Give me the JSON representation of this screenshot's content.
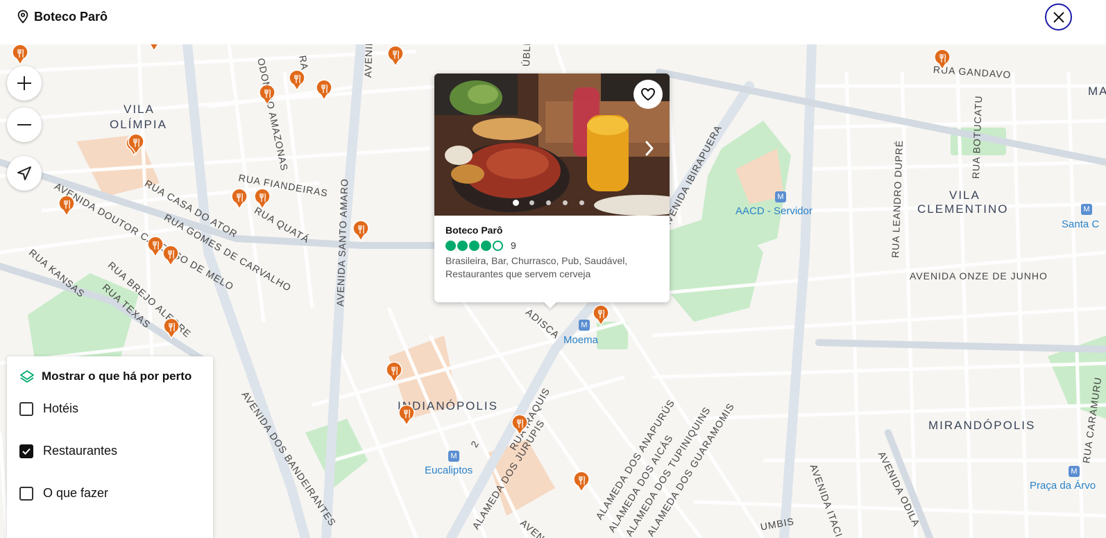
{
  "header": {
    "title": "Boteco Parô"
  },
  "popup": {
    "name": "Boteco Parô",
    "rating_bubbles": 4,
    "rating_max": 5,
    "review_count": "9",
    "cuisines": "Brasileira, Bar, Churrasco, Pub, Saudável, Restaurantes que servem cerveja",
    "photo_count": 5,
    "photo_index": 1
  },
  "filter": {
    "title": "Mostrar o que há por perto",
    "options": [
      {
        "label": "Hotéis",
        "checked": false
      },
      {
        "label": "Restaurantes",
        "checked": true
      },
      {
        "label": "O que fazer",
        "checked": false
      }
    ]
  },
  "map": {
    "districts": [
      "VILA",
      "OLÍMPIA",
      "VILA",
      "CLEMENTINO",
      "INDIANÓPOLIS",
      "MIRANDÓPOLIS"
    ],
    "streets": [
      "RUA FIANDEIRAS",
      "AVENIDA SANTO AMARO",
      "RUA CASA DO ATOR",
      "RUA QUATÁ",
      "RUA GOMES DE CARVALHO",
      "AVENIDA DOUTOR CARDOSO DE MELO",
      "RUA KANSAS",
      "RUA BREJO ALEGRE",
      "RUA TEXAS",
      "AVENIDA IBIRAPUERA",
      "RUA GANDAVO",
      "RUA BOTUCATU",
      "RUA LEANDRO DUPRÉ",
      "AVENIDA ONZE DE JUNHO",
      "AVENIDA DOS BANDEIRANTES",
      "ALAMEDA DOS JURUPIS",
      "ALAMEDA DOS ANAPURÚS",
      "ALAMEDA DOS AICÁS",
      "ALAMEDA DOS TUPINIQUINS",
      "ALAMEDA DOS GUARAMOMIS",
      "AVENIDA ODILA",
      "RUA CARAMURU",
      "AVENIDA ITACI",
      "RUA IRAQUIS",
      "AVENIDA SA",
      "ODOMIRO AMAZONAS",
      "ÚBLI",
      "RA",
      "ADISCA",
      "MA",
      "UMBIS",
      "AVENI",
      "2"
    ],
    "pois": [
      "AACD - Servidor",
      "Moema",
      "Eucaliptos",
      "Santa C",
      "Praça da Árvo"
    ]
  },
  "colors": {
    "rating": "#00aa6c",
    "restaurant_marker": "#e06a1b",
    "close_ring": "#1a1aa8",
    "poi": "#2a82c8"
  },
  "icons": [
    "map-pin-icon",
    "close-icon",
    "plus-icon",
    "minus-icon",
    "locate-icon",
    "heart-icon",
    "chevron-right-icon",
    "layers-icon",
    "checkmark-icon",
    "restaurant-marker-icon"
  ]
}
